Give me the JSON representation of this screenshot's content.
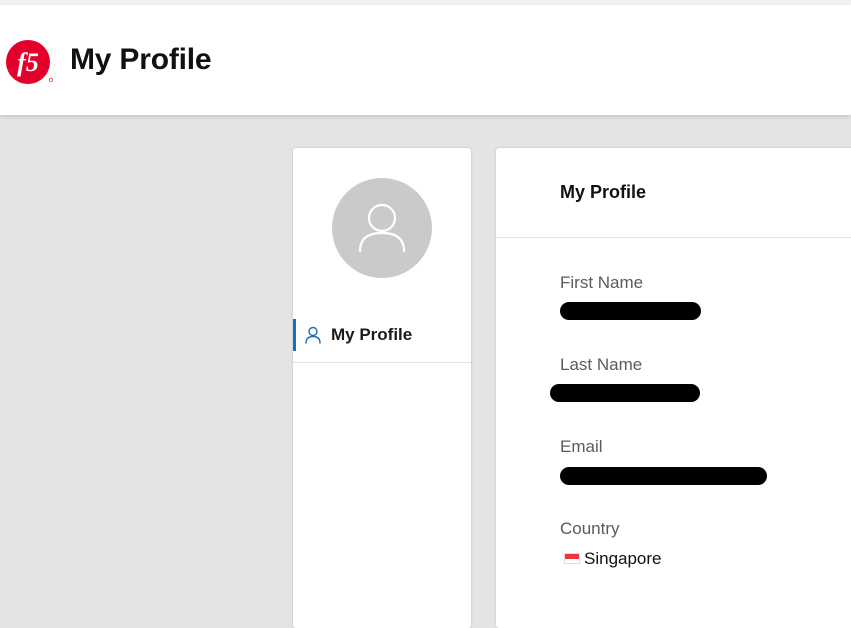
{
  "header": {
    "logo_text": "f5",
    "title": "My Profile"
  },
  "sidebar": {
    "items": [
      {
        "label": "My Profile",
        "icon": "user-icon",
        "active": true
      }
    ]
  },
  "profile": {
    "title": "My Profile",
    "fields": {
      "first_name_label": "First Name",
      "last_name_label": "Last Name",
      "email_label": "Email",
      "country_label": "Country",
      "country_value": "Singapore"
    }
  },
  "colors": {
    "brand_red": "#e4002b",
    "accent_blue": "#1a6fb5",
    "background": "#e4e4e4"
  }
}
